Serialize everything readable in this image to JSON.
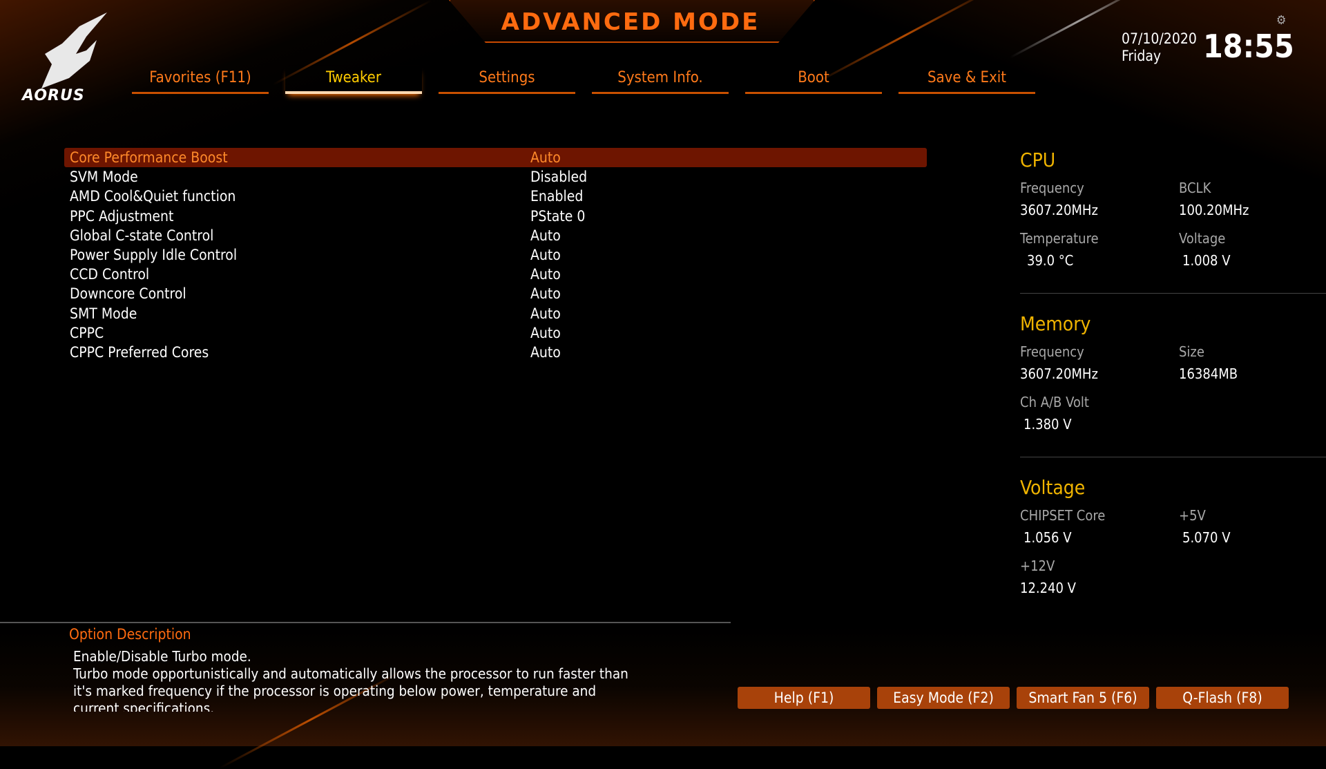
{
  "header": {
    "title": "ADVANCED MODE",
    "brand": "AORUS",
    "date": "07/10/2020",
    "day": "Friday",
    "time": "18:55"
  },
  "tabs": [
    {
      "label": "Favorites (F11)"
    },
    {
      "label": "Tweaker",
      "active": true
    },
    {
      "label": "Settings"
    },
    {
      "label": "System Info."
    },
    {
      "label": "Boot"
    },
    {
      "label": "Save & Exit"
    }
  ],
  "settings": [
    {
      "label": "Core Performance Boost",
      "value": "Auto",
      "selected": true
    },
    {
      "label": "SVM Mode",
      "value": "Disabled"
    },
    {
      "label": "AMD Cool&Quiet function",
      "value": "Enabled"
    },
    {
      "label": "PPC Adjustment",
      "value": "PState 0"
    },
    {
      "label": "Global C-state Control",
      "value": "Auto"
    },
    {
      "label": "Power Supply Idle Control",
      "value": "Auto"
    },
    {
      "label": "CCD Control",
      "value": "Auto"
    },
    {
      "label": "Downcore Control",
      "value": "Auto"
    },
    {
      "label": "SMT Mode",
      "value": "Auto"
    },
    {
      "label": "CPPC",
      "value": "Auto"
    },
    {
      "label": "CPPC Preferred Cores",
      "value": "Auto"
    }
  ],
  "panel": {
    "cpu": {
      "title": "CPU",
      "freq_label": "Frequency",
      "freq": "3607.20MHz",
      "bclk_label": "BCLK",
      "bclk": "100.20MHz",
      "temp_label": "Temperature",
      "temp": "39.0 °C",
      "volt_label": "Voltage",
      "volt": "1.008 V"
    },
    "memory": {
      "title": "Memory",
      "freq_label": "Frequency",
      "freq": "3607.20MHz",
      "size_label": "Size",
      "size": "16384MB",
      "chvolt_label": "Ch A/B Volt",
      "chvolt": "1.380 V"
    },
    "voltage": {
      "title": "Voltage",
      "chipset_label": "CHIPSET Core",
      "chipset": "1.056 V",
      "p5_label": "+5V",
      "p5": "5.070 V",
      "p12_label": "+12V",
      "p12": "12.240 V"
    }
  },
  "description": {
    "heading": "Option Description",
    "lines": [
      "Enable/Disable Turbo mode.",
      "Turbo mode opportunistically and automatically allows the processor to run faster than",
      "it's marked frequency if the processor is operating below power, temperature and",
      "current specifications."
    ]
  },
  "buttons": [
    {
      "label": "Help (F1)"
    },
    {
      "label": "Easy Mode (F2)"
    },
    {
      "label": "Smart Fan 5 (F6)"
    },
    {
      "label": "Q-Flash (F8)"
    }
  ],
  "colors": {
    "accent": "#ff6b10",
    "active_tab": "#ffcc00",
    "heading": "#f0b400",
    "selected_row": "#6e1500"
  }
}
